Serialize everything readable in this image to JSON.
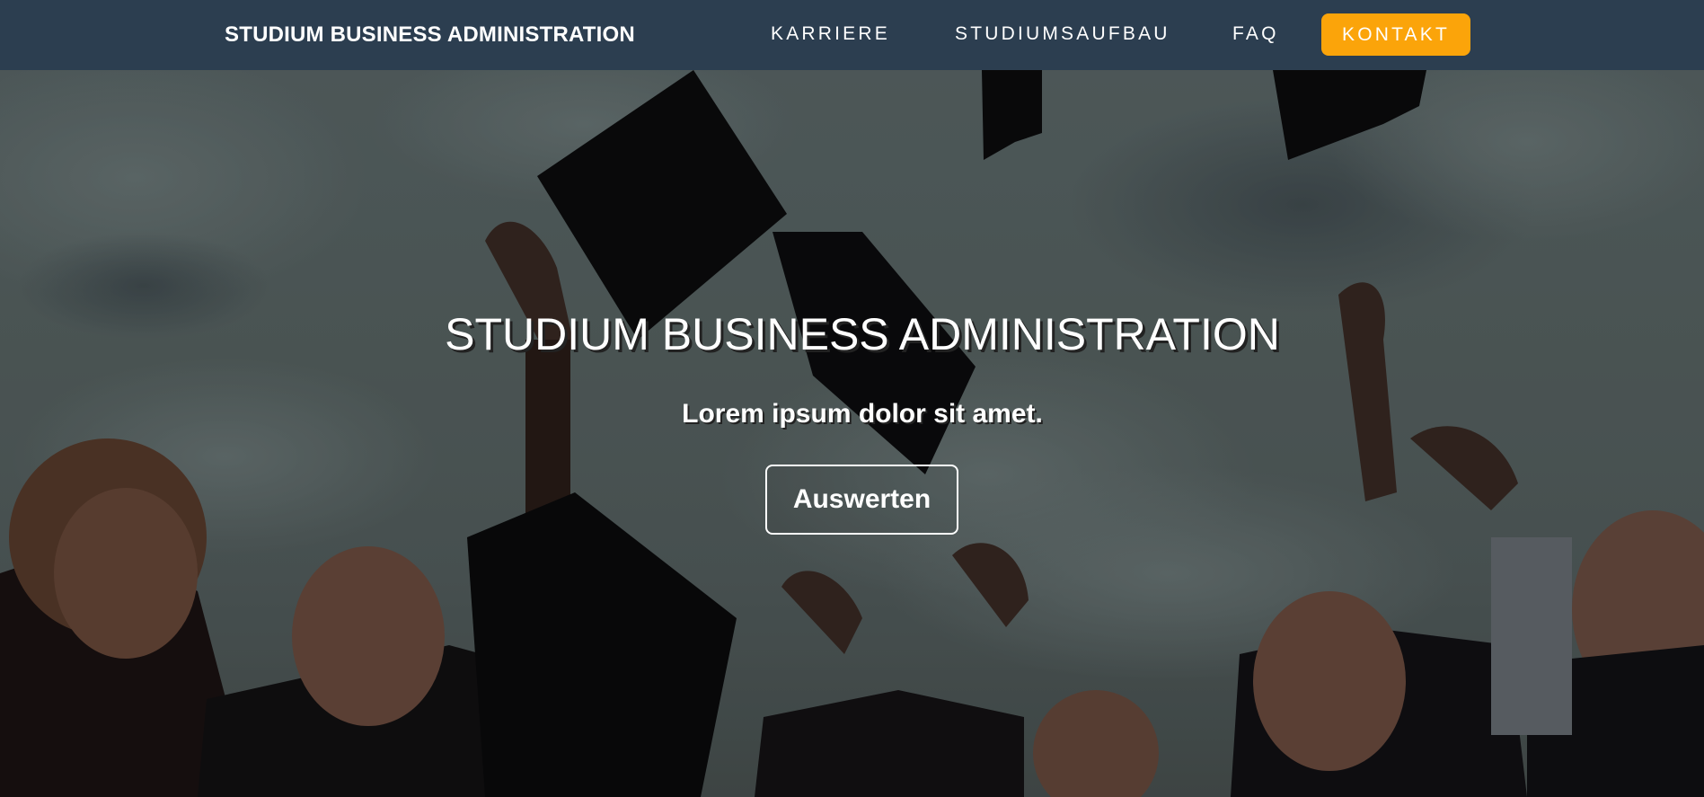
{
  "navbar": {
    "brand": "STUDIUM BUSINESS ADMINISTRATION",
    "links": [
      {
        "label": "KARRIERE"
      },
      {
        "label": "STUDIUMSAUFBAU"
      },
      {
        "label": "FAQ"
      }
    ],
    "cta": {
      "label": "KONTAKT",
      "color": "#fba40a"
    },
    "background": "#2c3e50"
  },
  "hero": {
    "title": "STUDIUM BUSINESS ADMINISTRATION",
    "subtitle": "Lorem ipsum dolor sit amet.",
    "button_label": "Auswerten",
    "background_image": "graduates-throwing-caps-photo"
  }
}
